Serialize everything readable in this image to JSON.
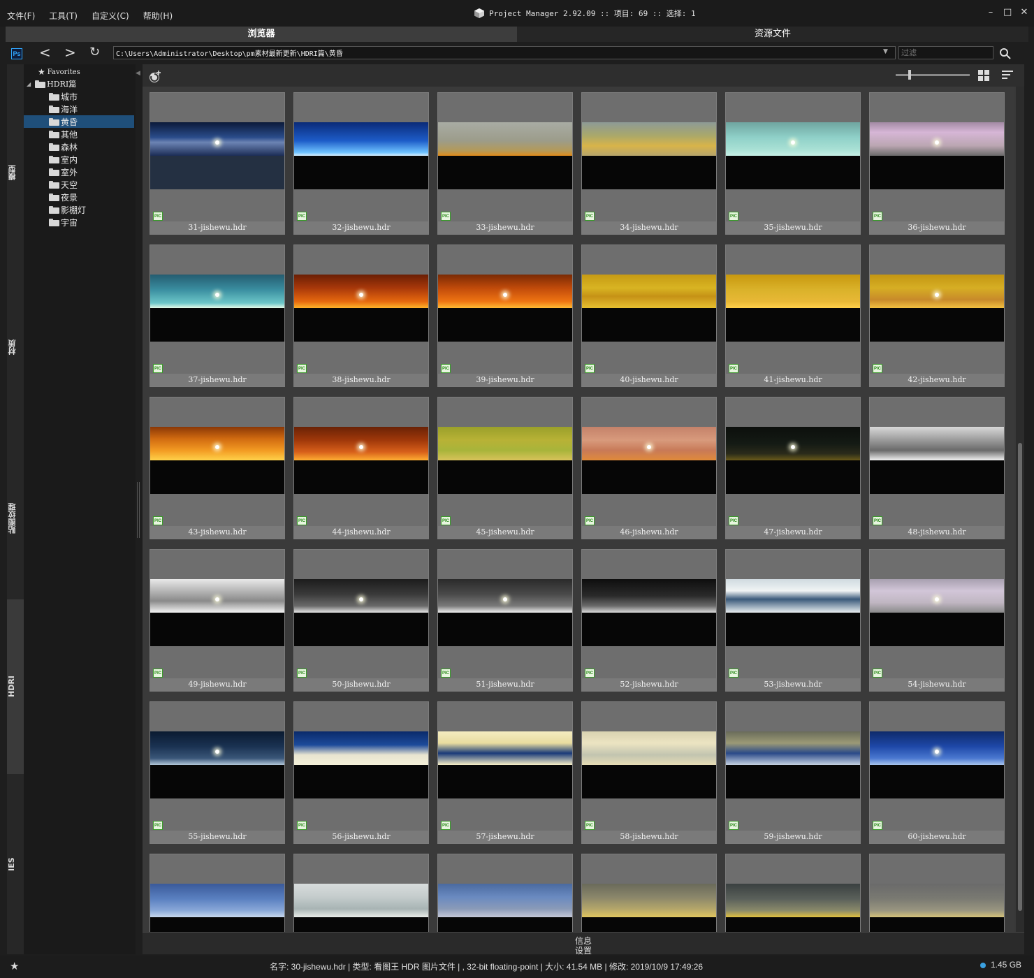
{
  "menu": [
    "文件(F)",
    "工具(T)",
    "自定义(C)",
    "帮助(H)"
  ],
  "title": "Project Manager 2.92.09  :: 项目: 69  :: 选择: 1",
  "window_controls": [
    "–",
    "□",
    "✕"
  ],
  "tabs": [
    "浏览器",
    "资源文件"
  ],
  "address": {
    "path": "C:\\Users\\Administrator\\Desktop\\pm素材最新更新\\HDRI篇\\黄昏",
    "filter_placeholder": "过滤"
  },
  "rail_tabs": [
    "模型",
    "材质",
    "贴图纹理",
    "HDRI",
    "IES"
  ],
  "tree": {
    "favorites": "Favorites",
    "root": "HDRI篇",
    "folders": [
      "城市",
      "海洋",
      "黄昏",
      "其他",
      "森林",
      "室内",
      "室外",
      "天空",
      "夜景",
      "影棚灯",
      "宇宙"
    ],
    "selected": "黄昏"
  },
  "grid_items": [
    {
      "name": "31-jishewu.hdr",
      "sky": "linear-gradient(180deg,#0b1a3a 0%,#2a4c8a 45%,#6c84b4 60%,#1c2d56 100%)",
      "sun": true,
      "ground": "#243042"
    },
    {
      "name": "32-jishewu.hdr",
      "sky": "linear-gradient(180deg,#0a2a78 0%,#1d5cc8 55%,#6ec2ff 90%,#d8f0ff 100%)",
      "sun": false,
      "ground": "#060606"
    },
    {
      "name": "33-jishewu.hdr",
      "sky": "linear-gradient(180deg,#a9aca4 0%,#9c9c8a 55%,#b49a58 85%,#e08a1a 100%)",
      "sun": false,
      "ground": "#060606"
    },
    {
      "name": "34-jishewu.hdr",
      "sky": "linear-gradient(180deg,#8d9a96 0%,#aaa86a 40%,#d8b44a 70%,#b6a56c 100%)",
      "sun": false,
      "ground": "#060606"
    },
    {
      "name": "35-jishewu.hdr",
      "sky": "linear-gradient(180deg,#6fa5a0 0%,#8fd0c8 45%,#a8e0d4 80%,#c7f0e6 100%)",
      "sun": true,
      "ground": "#060606"
    },
    {
      "name": "36-jishewu.hdr",
      "sky": "linear-gradient(180deg,#a38aa4 0%,#d6b6d6 30%,#bba6b2 70%,#6a6a6a 100%)",
      "sun": true,
      "ground": "#060606"
    },
    {
      "name": "37-jishewu.hdr",
      "sky": "linear-gradient(180deg,#245c70 0%,#3a8ea0 45%,#6cc6c8 85%,#e4fbe8 100%)",
      "sun": true,
      "ground": "#060606"
    },
    {
      "name": "38-jishewu.hdr",
      "sky": "linear-gradient(180deg,#6a1e04 0%,#a8380a 40%,#e6680e 80%,#ffb32a 100%)",
      "sun": true,
      "ground": "#060606"
    },
    {
      "name": "39-jishewu.hdr",
      "sky": "linear-gradient(180deg,#7a2a04 0%,#c04a0a 40%,#ef7412 80%,#ffba34 100%)",
      "sun": true,
      "ground": "#060606"
    },
    {
      "name": "40-jishewu.hdr",
      "sky": "linear-gradient(180deg,#c69a14 0%,#d8b422 40%,#c69216 65%,#e6c030 100%)",
      "sun": false,
      "ground": "#060606"
    },
    {
      "name": "41-jishewu.hdr",
      "sky": "linear-gradient(180deg,#c8980e 0%,#dab22a 45%,#e8b836 80%,#ffd04a 100%)",
      "sun": false,
      "ground": "#060606"
    },
    {
      "name": "42-jishewu.hdr",
      "sky": "linear-gradient(180deg,#c39612 0%,#d6ae24 40%,#c88a2a 75%,#f2c040 100%)",
      "sun": true,
      "ground": "#060606"
    },
    {
      "name": "43-jishewu.hdr",
      "sky": "linear-gradient(180deg,#8a3806 0%,#d06a10 35%,#f29a22 70%,#ffd24a 100%)",
      "sun": true,
      "ground": "#060606"
    },
    {
      "name": "44-jishewu.hdr",
      "sky": "linear-gradient(180deg,#6a2206 0%,#a0380a 40%,#d8601a 75%,#ffae32 100%)",
      "sun": true,
      "ground": "#060606"
    },
    {
      "name": "45-jishewu.hdr",
      "sky": "linear-gradient(180deg,#9aa02a 0%,#b8b236 40%,#a8b43a 70%,#d8c25a 100%)",
      "sun": false,
      "ground": "#060606"
    },
    {
      "name": "46-jishewu.hdr",
      "sky": "linear-gradient(180deg,#c4826a 0%,#d89a7c 40%,#c87a58 70%,#e08a3a 100%)",
      "sun": true,
      "ground": "#060606"
    },
    {
      "name": "47-jishewu.hdr",
      "sky": "linear-gradient(180deg,#0c0f0c 0%,#141a14 50%,#2a2a1a 80%,#6a5a1a 100%)",
      "sun": true,
      "ground": "#060606"
    },
    {
      "name": "48-jishewu.hdr",
      "sky": "linear-gradient(180deg,#d8d8d8 0%,#9a9a9a 40%,#6a6a6a 70%,#f0f0f0 100%)",
      "sun": false,
      "ground": "#060606"
    },
    {
      "name": "49-jishewu.hdr",
      "sky": "linear-gradient(180deg,#e8e8e8 0%,#b6b6b6 35%,#8a8a8a 65%,#f4f4f4 100%)",
      "sun": true,
      "ground": "#060606"
    },
    {
      "name": "50-jishewu.hdr",
      "sky": "linear-gradient(180deg,#1c1c1c 0%,#3a3a3a 45%,#6a6a6a 80%,#e6e6e6 100%)",
      "sun": true,
      "ground": "#060606"
    },
    {
      "name": "51-jishewu.hdr",
      "sky": "linear-gradient(180deg,#2a2a2a 0%,#4a4a4a 45%,#7a7a7a 80%,#f2f2f2 100%)",
      "sun": true,
      "ground": "#060606"
    },
    {
      "name": "52-jishewu.hdr",
      "sky": "linear-gradient(180deg,#0e0e0e 0%,#2a2a2a 50%,#6a6a6a 80%,#dcdcdc 100%)",
      "sun": false,
      "ground": "#060606"
    },
    {
      "name": "53-jishewu.hdr",
      "sky": "linear-gradient(180deg,#d0dae0 0%,#f0f4f4 35%,#3a5a7a 60%,#e8eef0 100%)",
      "sun": false,
      "ground": "#060606"
    },
    {
      "name": "54-jishewu.hdr",
      "sky": "linear-gradient(180deg,#a8a0b0 0%,#d2c6d8 35%,#c0b6c2 70%,#8a8a8a 100%)",
      "sun": true,
      "ground": "#060606"
    },
    {
      "name": "55-jishewu.hdr",
      "sky": "linear-gradient(180deg,#0a1a30 0%,#1a3252 45%,#3a5678 80%,#b0c6d8 100%)",
      "sun": true,
      "ground": "#060606"
    },
    {
      "name": "56-jishewu.hdr",
      "sky": "linear-gradient(180deg,#0a2a6a 0%,#1c4a9a 40%,#e8e4d0 70%,#f4f0d8 100%)",
      "sun": false,
      "ground": "#060606"
    },
    {
      "name": "57-jishewu.hdr",
      "sky": "linear-gradient(180deg,#f4ecc0 0%,#e8dca0 35%,#1a3a78 65%,#f6eec6 100%)",
      "sun": false,
      "ground": "#060606"
    },
    {
      "name": "58-jishewu.hdr",
      "sky": "linear-gradient(180deg,#d8d2b0 0%,#ece4c2 35%,#c2c4b0 70%,#e6dcb4 100%)",
      "sun": false,
      "ground": "#060606"
    },
    {
      "name": "59-jishewu.hdr",
      "sky": "linear-gradient(180deg,#6a6c5a 0%,#9c9a76 35%,#2a4a88 65%,#c4d0e0 100%)",
      "sun": false,
      "ground": "#060606"
    },
    {
      "name": "60-jishewu.hdr",
      "sky": "linear-gradient(180deg,#0e2a6a 0%,#1e48a8 45%,#4a78d0 80%,#a8c4ee 100%)",
      "sun": true,
      "ground": "#060606"
    },
    {
      "name": "",
      "sky": "linear-gradient(180deg,#3a5a9a 0%,#5a80c0 45%,#8aa8d8 80%,#c8d8ee 100%)",
      "sun": false,
      "ground": "#060606"
    },
    {
      "name": "",
      "sky": "linear-gradient(180deg,#d8dcdc 0%,#c4cccc 40%,#a8b4b4 75%,#e8ece8 100%)",
      "sun": false,
      "ground": "#060606"
    },
    {
      "name": "",
      "sky": "linear-gradient(180deg,#4a6aa0 0%,#6a8ac0 40%,#8a9ab8 75%,#c4c8d8 100%)",
      "sun": false,
      "ground": "#060606"
    },
    {
      "name": "",
      "sky": "linear-gradient(180deg,#6a6a5a 0%,#8a866a 40%,#b4a66a 75%,#e0c660 100%)",
      "sun": false,
      "ground": "#060606"
    },
    {
      "name": "",
      "sky": "linear-gradient(180deg,#3a4040 0%,#5a605a 45%,#8a8a6a 80%,#e0c040 100%)",
      "sun": false,
      "ground": "#060606"
    },
    {
      "name": "",
      "sky": "linear-gradient(180deg,#6a6a6a 0%,#7a7a72 45%,#9a9680 80%,#d4c27a 100%)",
      "sun": false,
      "ground": "#060606"
    }
  ],
  "pic_badge": "PIC",
  "bottom_panel": {
    "info": "信息",
    "settings": "设置"
  },
  "status": {
    "text": "名字: 30-jishewu.hdr | 类型: 看图王 HDR 图片文件 | , 32-bit floating-point | 大小: 41.54 MB | 修改: 2019/10/9 17:49:26",
    "disk": "1.45 GB",
    "star": "★"
  }
}
